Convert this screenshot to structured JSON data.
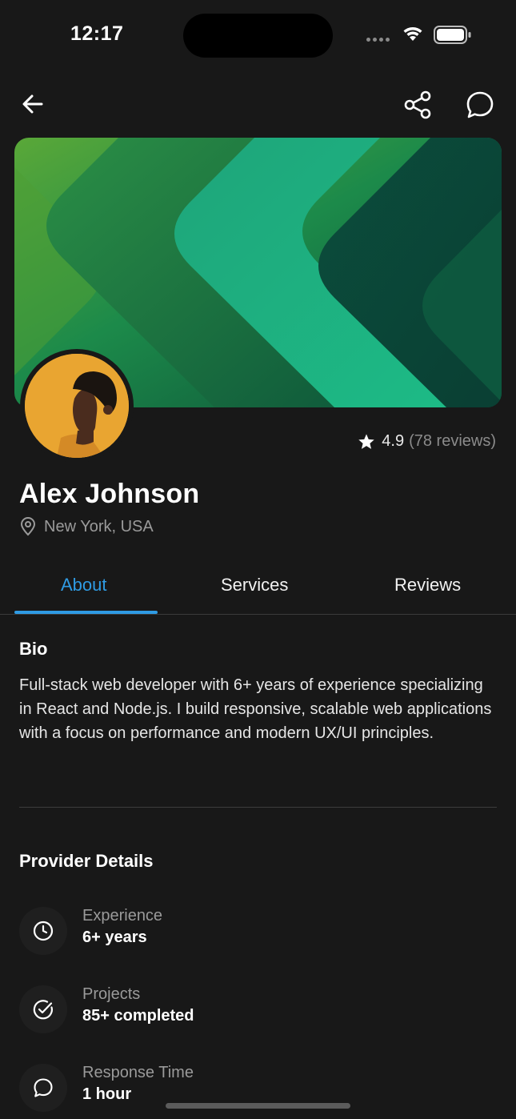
{
  "status_bar": {
    "time": "12:17"
  },
  "nav": {
    "back_icon": "arrow-left-icon",
    "share_icon": "share-icon",
    "chat_icon": "chat-bubble-icon"
  },
  "profile": {
    "name": "Alex Johnson",
    "location": "New York, USA",
    "rating": "4.9",
    "reviews": "(78 reviews)"
  },
  "tabs": [
    {
      "label": "About",
      "active": true
    },
    {
      "label": "Services",
      "active": false
    },
    {
      "label": "Reviews",
      "active": false
    }
  ],
  "bio": {
    "title": "Bio",
    "text": "Full-stack web developer with 6+ years of experience specializing in React and Node.js. I build responsive, scalable web applications with a focus on performance and modern UX/UI principles."
  },
  "provider_details": {
    "title": "Provider Details",
    "items": [
      {
        "icon": "clock-icon",
        "label": "Experience",
        "value": "6+ years"
      },
      {
        "icon": "check-circle-icon",
        "label": "Projects",
        "value": "85+ completed"
      },
      {
        "icon": "chat-bubble-icon",
        "label": "Response Time",
        "value": "1 hour"
      }
    ]
  },
  "colors": {
    "background": "#181818",
    "accent": "#2f9be3",
    "muted_text": "#9a9a9a",
    "avatar_bg": "#e9a531"
  }
}
